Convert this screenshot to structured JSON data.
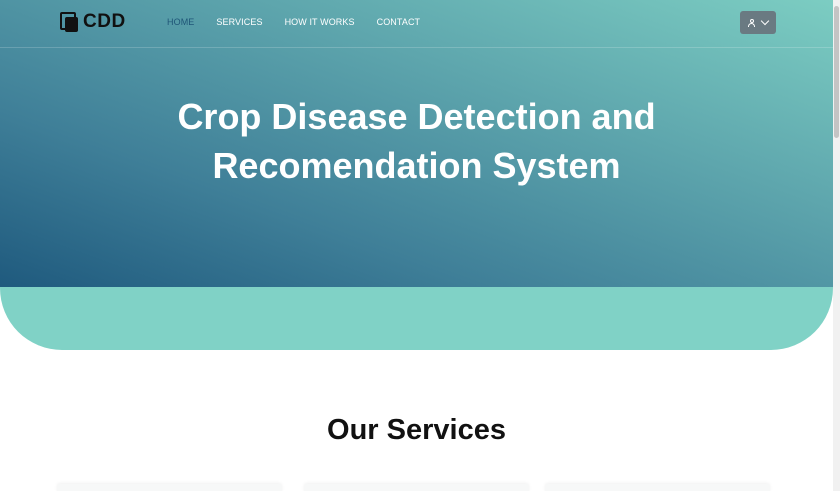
{
  "brand": {
    "logo_text": "CDD",
    "icon": "logo-squares-icon"
  },
  "nav": {
    "items": [
      {
        "label": "HOME",
        "active": true
      },
      {
        "label": "SERVICES",
        "active": false
      },
      {
        "label": "HOW IT WORKS",
        "active": false
      },
      {
        "label": "CONTACT",
        "active": false
      }
    ]
  },
  "user_menu": {
    "icon": "user-icon",
    "chevron": "chevron-down-icon"
  },
  "hero": {
    "title_line1": "Crop Disease Detection and",
    "title_line2": "Recomendation System"
  },
  "services": {
    "title": "Our Services"
  },
  "colors": {
    "hero_light": "#7ccdc2",
    "hero_dark": "#1f5a7e",
    "band": "#80d2c6",
    "active_nav": "#1f5577",
    "user_button": "#6a7a82"
  }
}
